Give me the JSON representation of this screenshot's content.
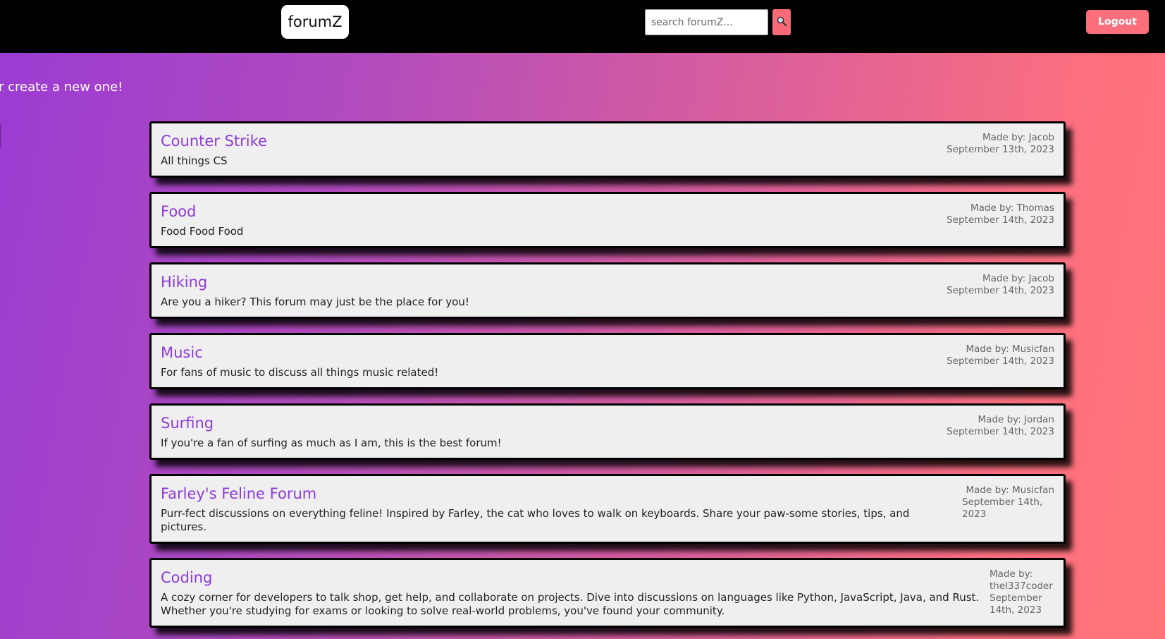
{
  "header": {
    "logo": "forumZ",
    "search_placeholder": "search forumZ...",
    "search_icon": "magnifier-icon",
    "logout_label": "Logout"
  },
  "intro_text": "r create a new one!",
  "colors": {
    "header_bg": "#000000",
    "accent": "#fb6f7c",
    "title_purple": "#8d3ad8",
    "card_bg": "#efefef"
  },
  "forums": [
    {
      "title": "Counter Strike",
      "description": "All things CS",
      "author": "Made by: Jacob",
      "date": "September 13th, 2023"
    },
    {
      "title": "Food",
      "description": "Food Food Food",
      "author": "Made by: Thomas",
      "date": "September 14th, 2023"
    },
    {
      "title": "Hiking",
      "description": "Are you a hiker? This forum may just be the place for you!",
      "author": "Made by: Jacob",
      "date": "September 14th, 2023"
    },
    {
      "title": "Music",
      "description": "For fans of music to discuss all things music related!",
      "author": "Made by: Musicfan",
      "date": "September 14th, 2023"
    },
    {
      "title": "Surfing",
      "description": "If you're a fan of surfing as much as I am, this is the best forum!",
      "author": "Made by: Jordan",
      "date": "September 14th, 2023"
    },
    {
      "title": "Farley's Feline Forum",
      "description": "Purr-fect discussions on everything feline! Inspired by Farley, the cat who loves to walk on keyboards. Share your paw-some stories, tips, and pictures.",
      "author": "Made by: Musicfan",
      "date": "September 14th, 2023"
    },
    {
      "title": "Coding",
      "description": "A cozy corner for developers to talk shop, get help, and collaborate on projects. Dive into discussions on languages like Python, JavaScript, Java, and Rust. Whether you're studying for exams or looking to solve real-world problems, you've found your community.",
      "author": "Made by: thel337coder",
      "date": "September 14th, 2023"
    }
  ]
}
